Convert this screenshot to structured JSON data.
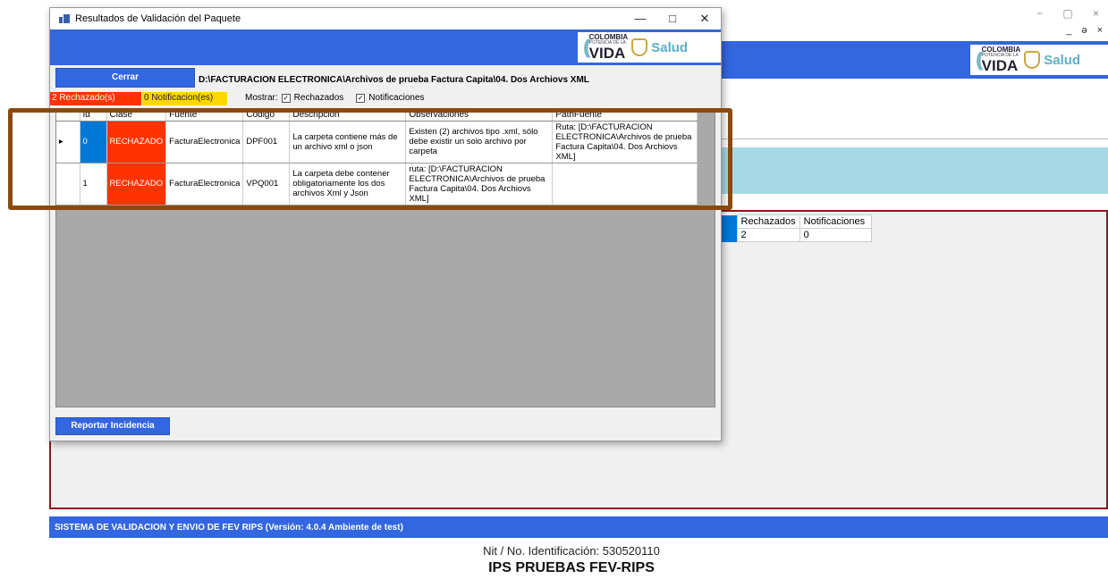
{
  "main_window": {
    "controls": [
      "−",
      "▢",
      "×"
    ],
    "sub_controls": "_ ə ×",
    "logo": {
      "line1": "COLOMBIA",
      "line2": "POTENCIA DE LA",
      "line3": "VIDA",
      "salud": "Salud"
    },
    "summary_table": {
      "headers": [
        "Rechazados",
        "Notificaciones"
      ],
      "values": [
        "2",
        "0"
      ]
    },
    "status_bar": "SISTEMA DE VALIDACION Y ENVIO DE FEV RIPS  (Versión: 4.0.4 Ambiente de test)",
    "nit_label": "Nit / No. Identificación: 530520110",
    "ips_name": "IPS PRUEBAS FEV-RIPS"
  },
  "dialog": {
    "title": "Resultados de Validación del Paquete",
    "close_button": "Cerrar",
    "path": "D:\\FACTURACION ELECTRONICA\\Archivos de prueba Factura Capita\\04. Dos Archiovs XML",
    "rechazados_badge": "2 Rechazado(s)",
    "notificaciones_badge": "0 Notificacion(es)",
    "mostrar_label": "Mostrar:",
    "chk_rechazados": "Rechazados",
    "chk_notificaciones": "Notificaciones",
    "report_button": "Reportar Incidencia",
    "grid": {
      "headers": [
        "Id",
        "Clase",
        "Fuente",
        "Codigo",
        "Descripcion",
        "Observaciones",
        "PathFuente"
      ],
      "rows": [
        {
          "id": "0",
          "clase": "RECHAZADO",
          "fuente": "FacturaElectronica",
          "codigo": "DPF001",
          "descripcion": "La carpeta contiene más de un archivo xml o json",
          "observaciones": "Existen (2) archivos tipo .xml, sólo debe existir un solo archivo por carpeta",
          "pathfuente": "Ruta: [D:\\FACTURACION ELECTRONICA\\Archivos de prueba Factura Capita\\04. Dos Archiovs XML]"
        },
        {
          "id": "1",
          "clase": "RECHAZADO",
          "fuente": "FacturaElectronica",
          "codigo": "VPQ001",
          "descripcion": "La carpeta debe contener obligatoriamente los dos archivos Xml y Json",
          "observaciones": "ruta: [D:\\FACTURACION ELECTRONICA\\Archivos de prueba Factura Capita\\04. Dos Archiovs XML]",
          "pathfuente": ""
        }
      ]
    }
  },
  "colors": {
    "accent_blue": "#3366e0",
    "rejected": "#ff3300",
    "notification": "#ffd700",
    "highlight": "#8a4a0e",
    "selected": "#0078d7"
  }
}
